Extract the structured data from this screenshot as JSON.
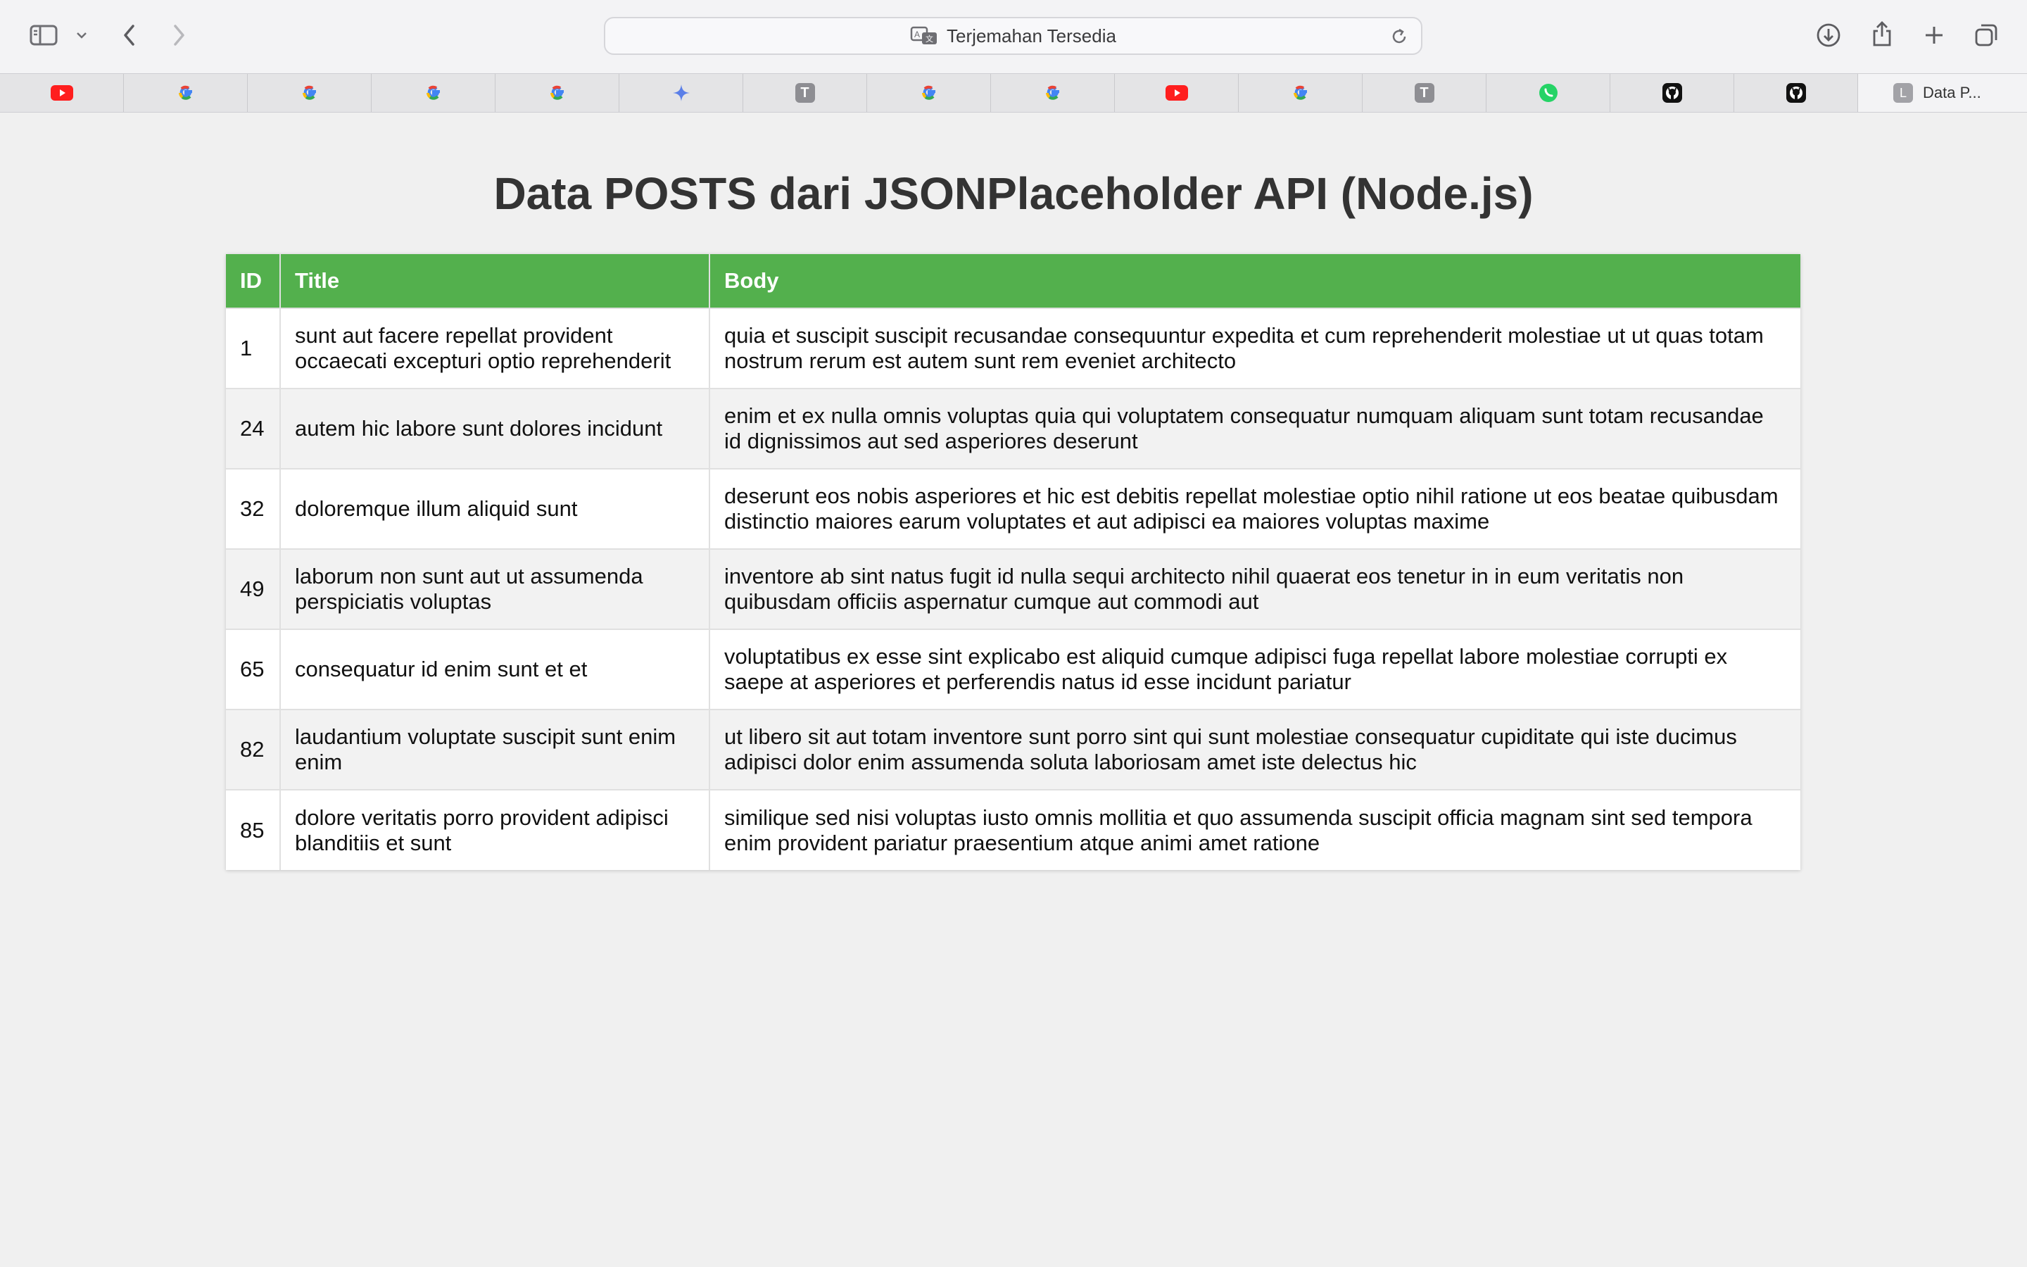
{
  "browser": {
    "address_bar": {
      "label": "Terjemahan Tersedia"
    },
    "tabs": [
      {
        "icon": "youtube-icon"
      },
      {
        "icon": "google-icon"
      },
      {
        "icon": "google-icon"
      },
      {
        "icon": "google-icon"
      },
      {
        "icon": "google-icon"
      },
      {
        "icon": "gemini-icon"
      },
      {
        "icon": "t-badge-icon",
        "badge": "T"
      },
      {
        "icon": "google-icon"
      },
      {
        "icon": "google-icon"
      },
      {
        "icon": "youtube-icon"
      },
      {
        "icon": "google-icon"
      },
      {
        "icon": "t-badge-icon",
        "badge": "T"
      },
      {
        "icon": "whatsapp-icon"
      },
      {
        "icon": "github-icon"
      },
      {
        "icon": "github-icon"
      }
    ],
    "active_tab": {
      "badge": "L",
      "title": "Data P..."
    }
  },
  "page": {
    "title": "Data POSTS dari JSONPlaceholder API (Node.js)",
    "table": {
      "headers": {
        "id": "ID",
        "title": "Title",
        "body": "Body"
      },
      "rows": [
        {
          "id": "1",
          "title": "sunt aut facere repellat provident occaecati excepturi optio reprehenderit",
          "body": "quia et suscipit suscipit recusandae consequuntur expedita et cum reprehenderit molestiae ut ut quas totam nostrum rerum est autem sunt rem eveniet architecto"
        },
        {
          "id": "24",
          "title": "autem hic labore sunt dolores incidunt",
          "body": "enim et ex nulla omnis voluptas quia qui voluptatem consequatur numquam aliquam sunt totam recusandae id dignissimos aut sed asperiores deserunt"
        },
        {
          "id": "32",
          "title": "doloremque illum aliquid sunt",
          "body": "deserunt eos nobis asperiores et hic est debitis repellat molestiae optio nihil ratione ut eos beatae quibusdam distinctio maiores earum voluptates et aut adipisci ea maiores voluptas maxime"
        },
        {
          "id": "49",
          "title": "laborum non sunt aut ut assumenda perspiciatis voluptas",
          "body": "inventore ab sint natus fugit id nulla sequi architecto nihil quaerat eos tenetur in in eum veritatis non quibusdam officiis aspernatur cumque aut commodi aut"
        },
        {
          "id": "65",
          "title": "consequatur id enim sunt et et",
          "body": "voluptatibus ex esse sint explicabo est aliquid cumque adipisci fuga repellat labore molestiae corrupti ex saepe at asperiores et perferendis natus id esse incidunt pariatur"
        },
        {
          "id": "82",
          "title": "laudantium voluptate suscipit sunt enim enim",
          "body": "ut libero sit aut totam inventore sunt porro sint qui sunt molestiae consequatur cupiditate qui iste ducimus adipisci dolor enim assumenda soluta laboriosam amet iste delectus hic"
        },
        {
          "id": "85",
          "title": "dolore veritatis porro provident adipisci blanditiis et sunt",
          "body": "similique sed nisi voluptas iusto omnis mollitia et quo assumenda suscipit officia magnam sint sed tempora enim provident pariatur praesentium atque animi amet ratione"
        }
      ]
    }
  },
  "colors": {
    "header_green": "#53b04d",
    "page_background": "#f0f0f0",
    "row_alt": "#f2f2f2"
  }
}
